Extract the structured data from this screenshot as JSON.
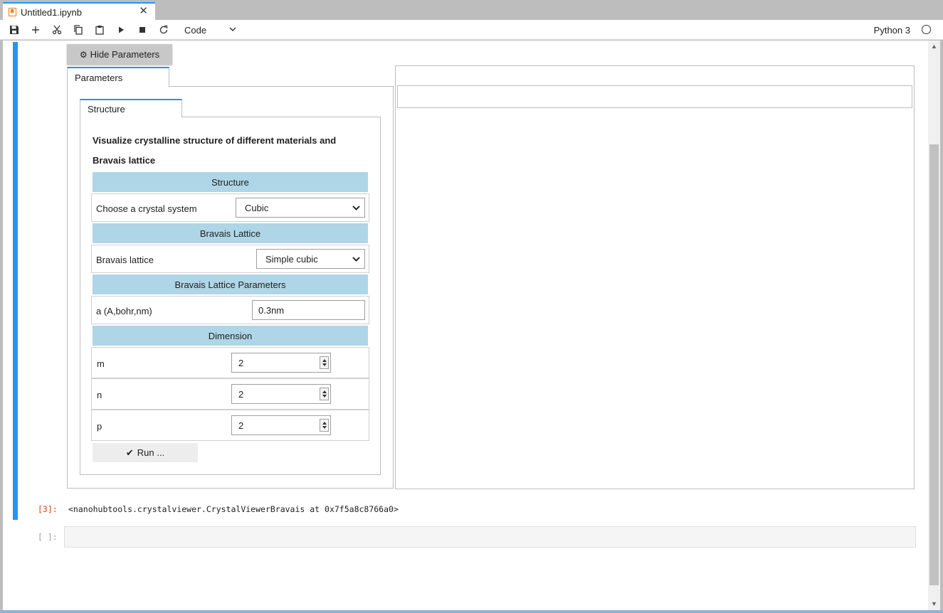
{
  "tab": {
    "title": "Untitled1.ipynb",
    "close": "✕"
  },
  "toolbar": {
    "cell_type": "Code",
    "kernel": "Python 3",
    "buttons": [
      "save-icon",
      "plus-icon",
      "cut-icon",
      "copy-icon",
      "paste-icon",
      "run-icon",
      "stop-icon",
      "restart-icon"
    ]
  },
  "widget": {
    "hide_params_label": "Hide Parameters",
    "outer_tab": "Parameters",
    "inner_tab": "Structure",
    "description_line1": "Visualize crystalline structure of different materials and",
    "description_line2": "Bravais lattice",
    "sections": {
      "structure": "Structure",
      "bravais": "Bravais Lattice",
      "params": "Bravais Lattice Parameters",
      "dimension": "Dimension"
    },
    "crystal_system": {
      "label": "Choose a crystal system",
      "value": "Cubic"
    },
    "bravais_lattice": {
      "label": "Bravais lattice",
      "value": "Simple cubic"
    },
    "lattice_a": {
      "label": "a (A,bohr,nm)",
      "value": "0.3nm"
    },
    "dims": [
      {
        "label": "m",
        "value": "2"
      },
      {
        "label": "n",
        "value": "2"
      },
      {
        "label": "p",
        "value": "2"
      }
    ],
    "run_label": "Run ..."
  },
  "output": {
    "prompt": "[3]:",
    "text": "<nanohubtools.crystalviewer.CrystalViewerBravais at 0x7f5a8c8766a0>"
  },
  "next_cell": {
    "prompt": "[ ]:"
  },
  "colors": {
    "accent": "#2196f3",
    "section_header": "#aed6e6",
    "out_prompt": "#d84315"
  }
}
